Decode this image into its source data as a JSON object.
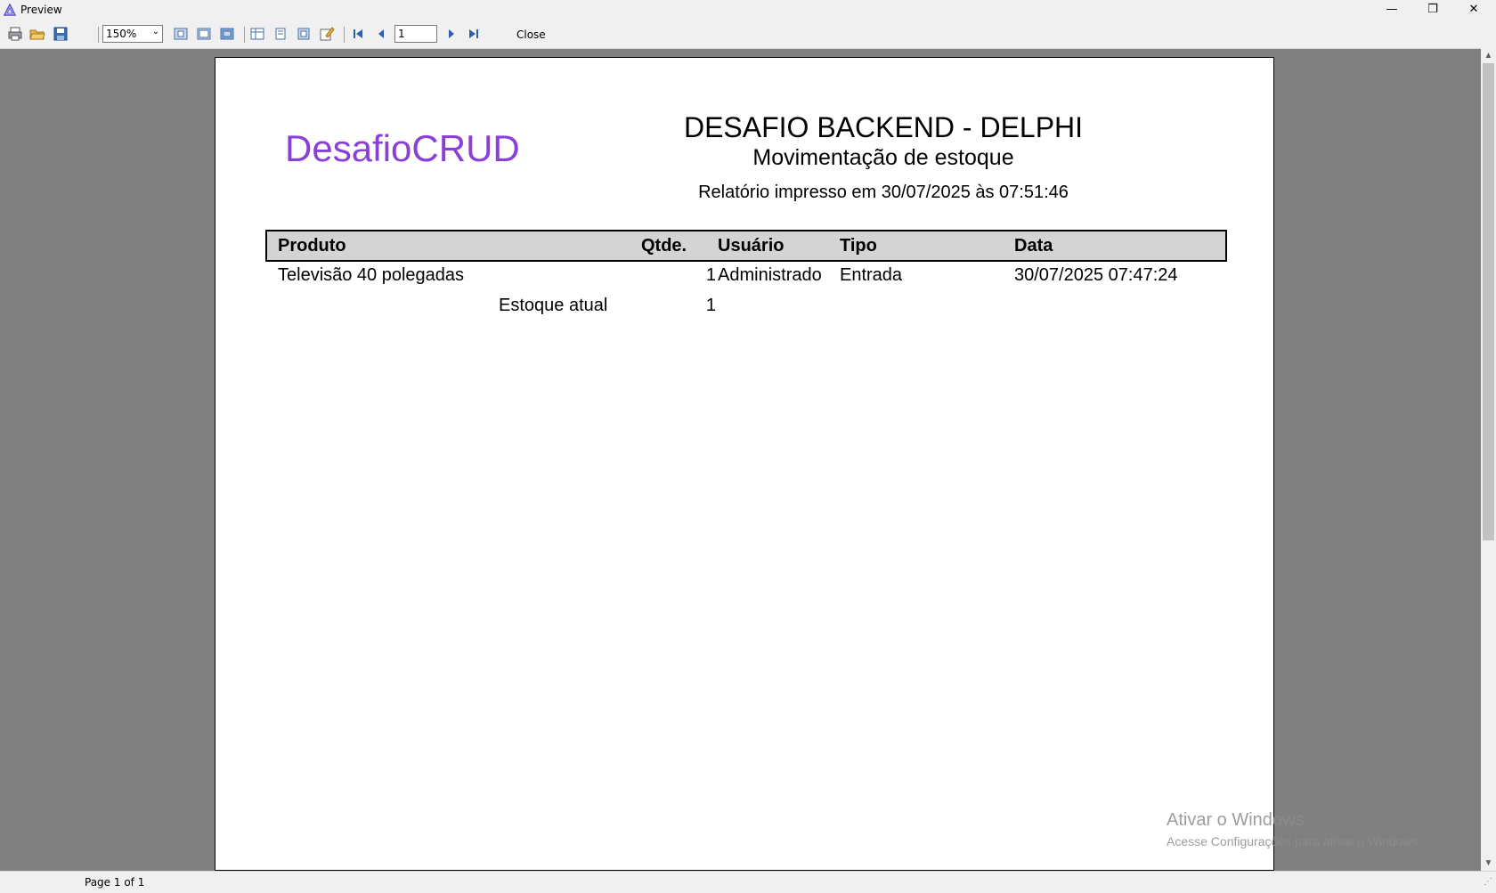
{
  "window": {
    "title": "Preview",
    "min_glyph": "—",
    "max_glyph": "❐",
    "close_glyph": "✕"
  },
  "toolbar": {
    "icons": [
      "print-icon",
      "open-icon",
      "save-icon",
      "fit-page-icon",
      "fit-width-icon",
      "actual-size-icon",
      "single-page-icon",
      "two-pages-icon",
      "four-pages-icon",
      "edit-icon",
      "first-page-icon",
      "prev-page-icon",
      "next-page-icon",
      "last-page-icon"
    ],
    "zoom_value": "150%",
    "zoom_arrow": "⌄",
    "page_number": "1",
    "close_label": "Close"
  },
  "report": {
    "logo_text": "DesafioCRUD",
    "title": "DESAFIO BACKEND - DELPHI",
    "subtitle": "Movimentação de estoque",
    "printed_at": "Relatório impresso em 30/07/2025 às 07:51:46",
    "columns": [
      "Produto",
      "Qtde.",
      "Usuário",
      "Tipo",
      "Data"
    ],
    "rows": [
      {
        "produto": "Televisão 40 polegadas",
        "qtde": "1",
        "usuario": "Administrado",
        "tipo": "Entrada",
        "data": "30/07/2025 07:47:24"
      }
    ],
    "summary_label": "Estoque atual",
    "summary_value": "1"
  },
  "status": {
    "page_info": "Page 1 of 1",
    "grip": "⋰"
  },
  "watermark": {
    "line1": "Ativar o Windows",
    "line2": "Acesse Configurações para ativar o Windows."
  },
  "scroll": {
    "up": "▲",
    "down": "▼"
  },
  "colors": {
    "logo": "#8a3fd6",
    "header_fill": "#d4d4d4",
    "background": "#808080"
  }
}
